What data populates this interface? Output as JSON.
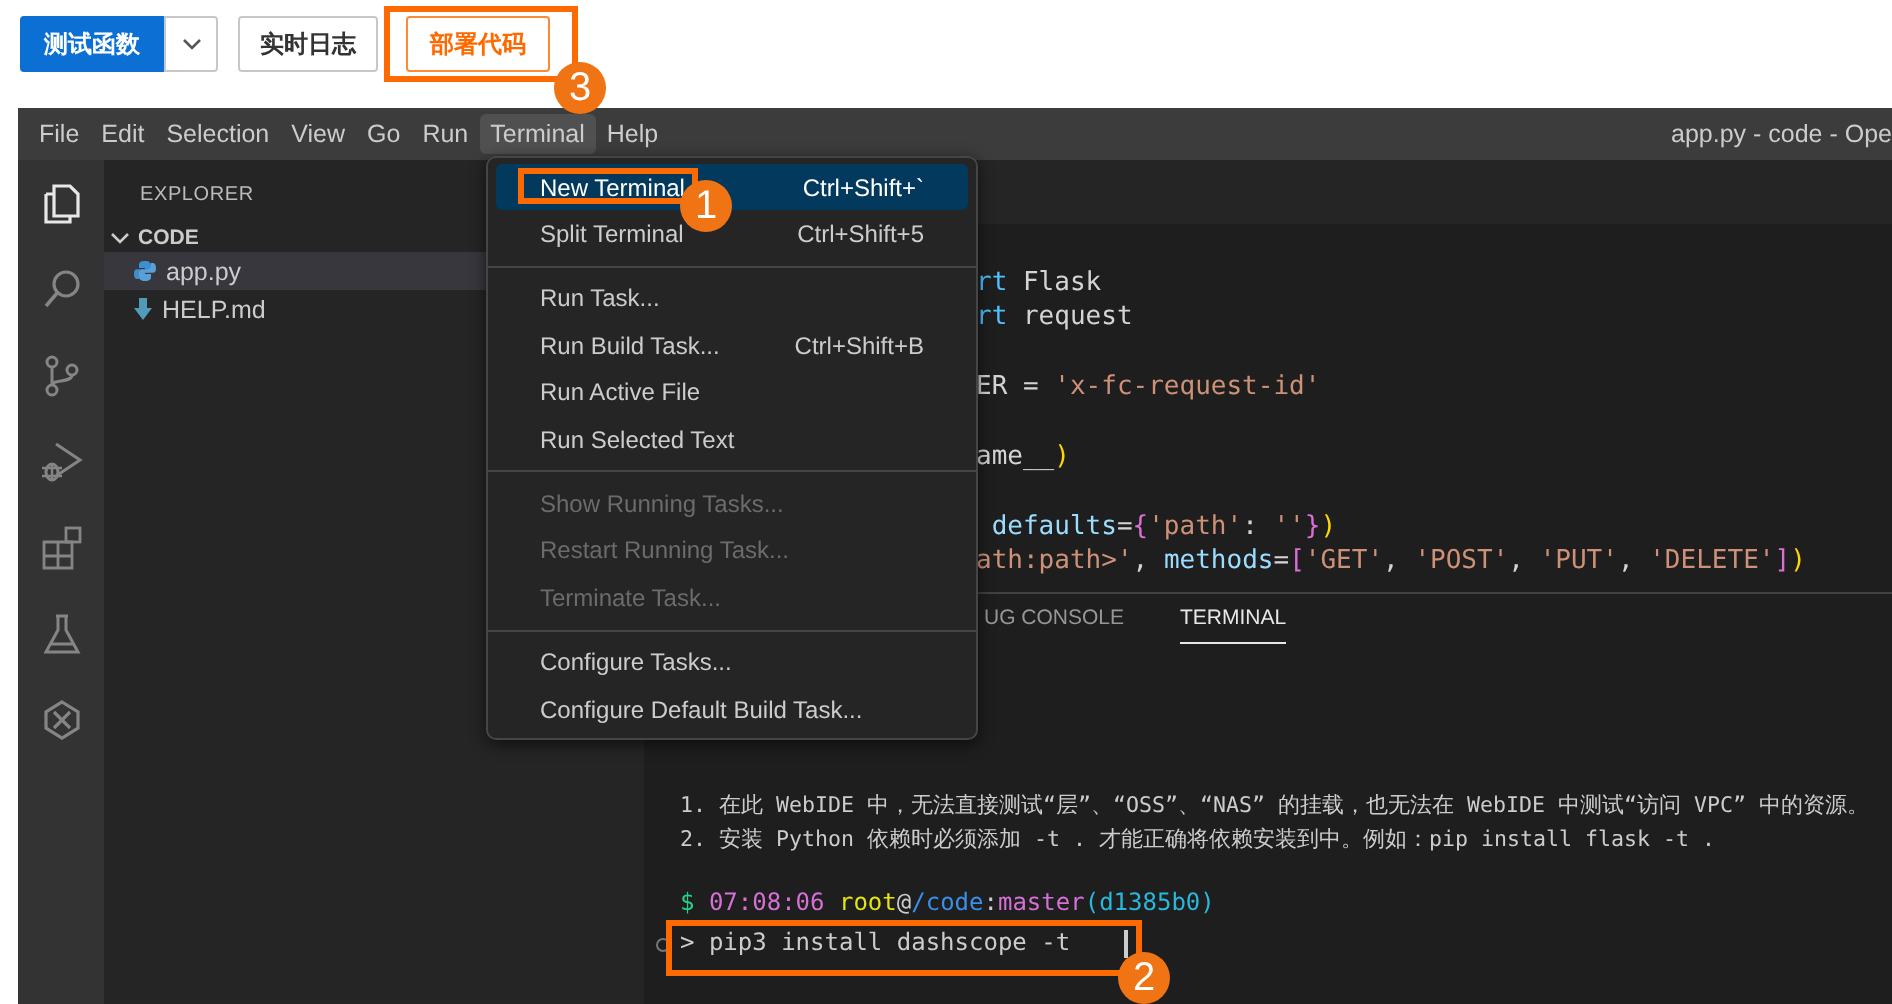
{
  "toolbar": {
    "buttons": [
      {
        "kind": "primary",
        "label": "测试函数",
        "highlighted": false
      },
      {
        "kind": "caret",
        "highlighted": false
      },
      {
        "kind": "default",
        "label": "实时日志",
        "highlighted": false
      },
      {
        "kind": "accent",
        "label": "部署代码",
        "highlighted": true,
        "callout": "3"
      }
    ]
  },
  "menu_bar": {
    "items": [
      {
        "label": "File",
        "selected": false
      },
      {
        "label": "Edit",
        "selected": false
      },
      {
        "label": "Selection",
        "selected": false
      },
      {
        "label": "View",
        "selected": false
      },
      {
        "label": "Go",
        "selected": false
      },
      {
        "label": "Run",
        "selected": false
      },
      {
        "label": "Terminal",
        "selected": true
      },
      {
        "label": "Help",
        "selected": false
      }
    ],
    "title": "app.py - code - Ope"
  },
  "activity_bar": [
    {
      "kind": "files",
      "selected": true
    },
    {
      "kind": "search",
      "selected": false
    },
    {
      "kind": "branch",
      "selected": false
    },
    {
      "kind": "debug",
      "selected": false
    },
    {
      "kind": "extensions",
      "selected": false
    },
    {
      "kind": "flask",
      "selected": false
    },
    {
      "kind": "remote",
      "selected": false
    }
  ],
  "sidebar": {
    "title": "EXPLORER",
    "section": {
      "label": "CODE",
      "expanded": true
    },
    "files": [
      {
        "name": "app.py",
        "kind": "python",
        "selected": true
      },
      {
        "name": "HELP.md",
        "kind": "markdown",
        "selected": false
      }
    ]
  },
  "editor": {
    "lines": [
      {
        "kind": "code",
        "tokens": [
          {
            "kind": "keyword",
            "text": "rt"
          },
          {
            "kind": "plain",
            "text": " Flask"
          }
        ]
      },
      {
        "kind": "code",
        "tokens": [
          {
            "kind": "keyword",
            "text": "rt"
          },
          {
            "kind": "plain",
            "text": " request"
          }
        ]
      },
      {
        "kind": "blank"
      },
      {
        "kind": "code",
        "tokens": [
          {
            "kind": "plain",
            "text": "ER = "
          },
          {
            "kind": "string",
            "text": "'x-fc-request-id'"
          }
        ]
      },
      {
        "kind": "blank"
      },
      {
        "kind": "code",
        "tokens": [
          {
            "kind": "plain",
            "text": "ame__"
          },
          {
            "kind": "bracket",
            "text": ")"
          }
        ]
      },
      {
        "kind": "blank"
      },
      {
        "kind": "code",
        "tokens": [
          {
            "kind": "param",
            "text": " defaults"
          },
          {
            "kind": "plain",
            "text": "="
          },
          {
            "kind": "bracket2",
            "text": "{"
          },
          {
            "kind": "string",
            "text": "'path'"
          },
          {
            "kind": "plain",
            "text": ": "
          },
          {
            "kind": "string",
            "text": "''"
          },
          {
            "kind": "bracket2",
            "text": "}"
          },
          {
            "kind": "bracket",
            "text": ")"
          }
        ]
      },
      {
        "kind": "code",
        "tokens": [
          {
            "kind": "string",
            "text": "ath:path>'"
          },
          {
            "kind": "plain",
            "text": ", "
          },
          {
            "kind": "param",
            "text": "methods"
          },
          {
            "kind": "plain",
            "text": "="
          },
          {
            "kind": "bracket2",
            "text": "["
          },
          {
            "kind": "string",
            "text": "'GET'"
          },
          {
            "kind": "plain",
            "text": ", "
          },
          {
            "kind": "string",
            "text": "'POST'"
          },
          {
            "kind": "plain",
            "text": ", "
          },
          {
            "kind": "string",
            "text": "'PUT'"
          },
          {
            "kind": "plain",
            "text": ", "
          },
          {
            "kind": "string",
            "text": "'DELETE'"
          },
          {
            "kind": "bracket2",
            "text": "]"
          },
          {
            "kind": "bracket",
            "text": ")"
          }
        ]
      }
    ]
  },
  "panel": {
    "tabs": [
      {
        "label": "UG CONSOLE",
        "selected": false
      },
      {
        "label": "TERMINAL",
        "selected": true
      }
    ],
    "terminal": {
      "notes": [
        "1. 在此 WebIDE 中，无法直接测试“层”、“OSS”、“NAS” 的挂载，也无法在 WebIDE 中测试“访问 VPC” 中的资源。",
        "2. 安装 Python 依赖时必须添加 -t . 才能正确将依赖安装到中。例如：pip install flask -t ."
      ],
      "prompt": [
        {
          "kind": "dollar",
          "text": "$ "
        },
        {
          "kind": "time",
          "text": "07:08:06 "
        },
        {
          "kind": "user",
          "text": "root"
        },
        {
          "kind": "plain",
          "text": "@"
        },
        {
          "kind": "path",
          "text": "/code"
        },
        {
          "kind": "plain",
          "text": ":"
        },
        {
          "kind": "branch",
          "text": "master"
        },
        {
          "kind": "hash",
          "text": "(d1385b0)"
        }
      ],
      "command": {
        "text": "> pip3 install dashscope -t",
        "highlighted": true,
        "callout": "2"
      }
    }
  },
  "menu": {
    "groups": [
      {
        "items": [
          {
            "label": "New Terminal",
            "shortcut": "Ctrl+Shift+`",
            "disabled": false,
            "selected": true,
            "highlighted": true,
            "callout": "1"
          },
          {
            "label": "Split Terminal",
            "shortcut": "Ctrl+Shift+5",
            "disabled": false,
            "selected": false,
            "highlighted": false
          }
        ]
      },
      {
        "items": [
          {
            "label": "Run Task...",
            "disabled": false,
            "selected": false,
            "highlighted": false
          },
          {
            "label": "Run Build Task...",
            "shortcut": "Ctrl+Shift+B",
            "disabled": false,
            "selected": false,
            "highlighted": false
          },
          {
            "label": "Run Active File",
            "disabled": false,
            "selected": false,
            "highlighted": false
          },
          {
            "label": "Run Selected Text",
            "disabled": false,
            "selected": false,
            "highlighted": false
          }
        ]
      },
      {
        "items": [
          {
            "label": "Show Running Tasks...",
            "disabled": true,
            "selected": false,
            "highlighted": false
          },
          {
            "label": "Restart Running Task...",
            "disabled": true,
            "selected": false,
            "highlighted": false
          },
          {
            "label": "Terminate Task...",
            "disabled": true,
            "selected": false,
            "highlighted": false
          }
        ]
      },
      {
        "items": [
          {
            "label": "Configure Tasks...",
            "disabled": false,
            "selected": false,
            "highlighted": false
          },
          {
            "label": "Configure Default Build Task...",
            "disabled": false,
            "selected": false,
            "highlighted": false
          }
        ]
      }
    ]
  }
}
